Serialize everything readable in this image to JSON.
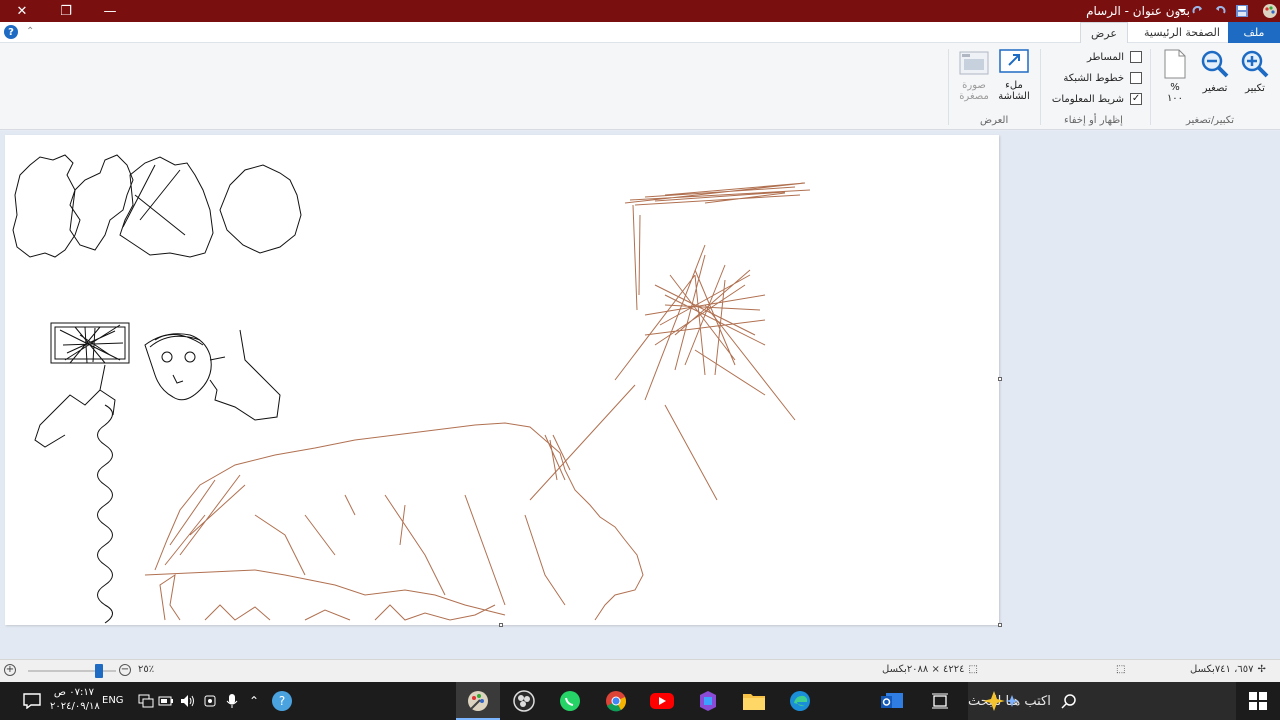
{
  "window": {
    "title": "بدون عنوان - الرسام",
    "close_glyph": "✕",
    "restore_glyph": "❐",
    "minimize_glyph": "—"
  },
  "tabs": {
    "file": "ملف",
    "home": "الصفحة الرئيسية",
    "view": "عرض"
  },
  "ribbon": {
    "zoom_in": "تكبير",
    "zoom_out": "تصغير",
    "zoom_100": "%\n١٠٠",
    "zoom_group": "تكبير/تصغير",
    "rulers": "المساطر",
    "gridlines": "خطوط الشبكة",
    "status_bar": "شريط المعلومات",
    "show_hide_group": "إظهار أو إخفاء",
    "fullscreen": "ملء\nالشاشة",
    "thumbnail": "صورة\nمصغرة",
    "display_group": "العرض"
  },
  "checks": {
    "rulers": false,
    "gridlines": false,
    "status_bar": true
  },
  "statusbar": {
    "cursor_pos": "٦٥٧، ٧٤١بكسل",
    "image_size": "٤٢٢٤ × ٢٠٨٨بكسل",
    "zoom_level": "٢٥٪",
    "zoom_fraction": 0.82
  },
  "taskbar": {
    "search_placeholder": "اكتب هنا للبحث",
    "language": "ENG",
    "time": "٠٧:١٧ ص",
    "date": "٢٠٢٤/٠٩/١٨"
  },
  "colors": {
    "titlebar": "#7a0f10",
    "accent": "#1e6bc4",
    "ink_black": "#111111",
    "ink_brown": "#b07050"
  }
}
